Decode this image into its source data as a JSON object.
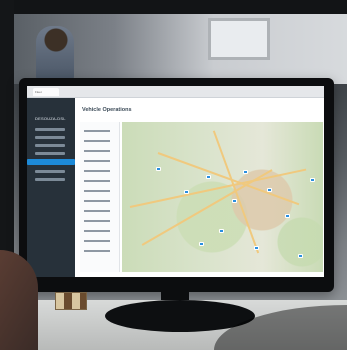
{
  "scene": {
    "monitor_title": "Vehicle Operations",
    "brand": "DESOUZA-DSL",
    "browser_tab": "Fleet"
  }
}
